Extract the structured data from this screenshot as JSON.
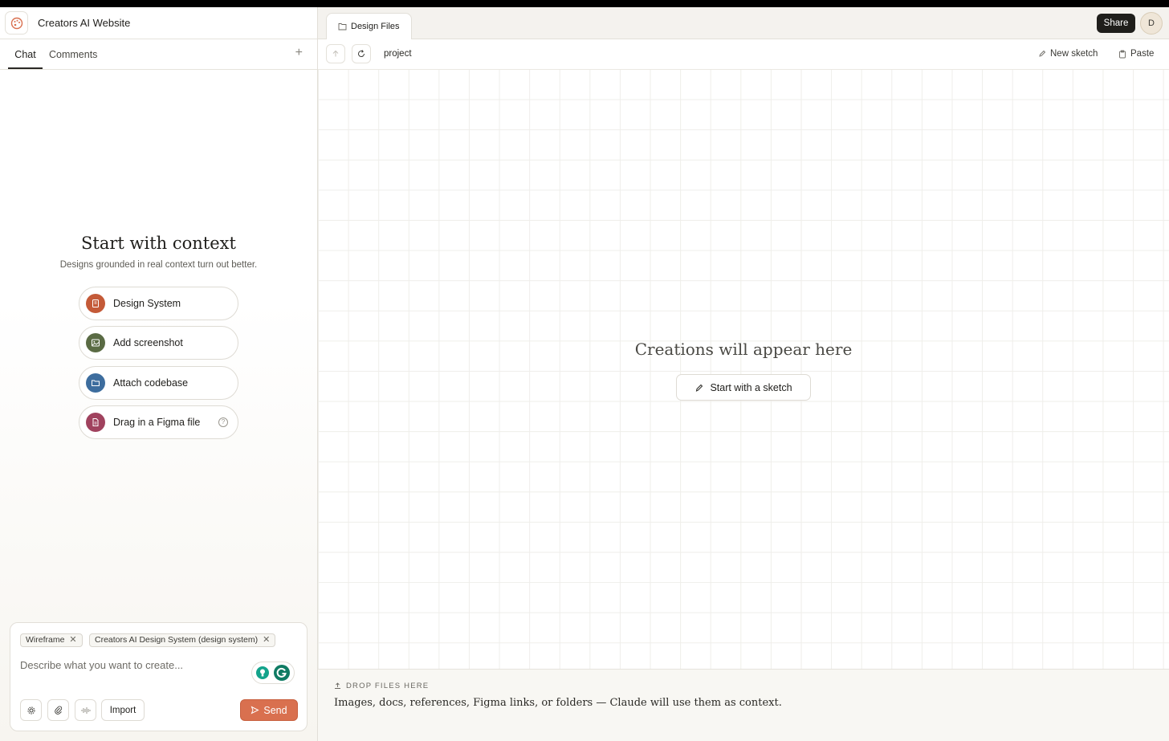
{
  "app": {
    "project_title": "Creators AI Website"
  },
  "left_tabs": {
    "chat": "Chat",
    "comments": "Comments",
    "add": "+"
  },
  "context": {
    "title": "Start with context",
    "subtitle": "Designs grounded in real context turn out better.",
    "options": [
      {
        "label": "Design System",
        "icon": "book-icon",
        "color": "#c45a38"
      },
      {
        "label": "Add screenshot",
        "icon": "image-icon",
        "color": "#5a6b44"
      },
      {
        "label": "Attach codebase",
        "icon": "folder-icon",
        "color": "#3d6d9e"
      },
      {
        "label": "Drag in a Figma file",
        "icon": "file-icon",
        "color": "#a0425e"
      }
    ],
    "help": "?"
  },
  "composer": {
    "chips": [
      {
        "label": "Wireframe"
      },
      {
        "label": "Creators AI Design System (design system)"
      }
    ],
    "chip_close": "✕",
    "placeholder": "Describe what you want to create...",
    "import_label": "Import",
    "send_label": "Send",
    "accent_color": "#d9704f"
  },
  "right_header": {
    "file_tab": "Design Files",
    "share": "Share",
    "avatar_initial": "D"
  },
  "toolbar": {
    "breadcrumb": "project",
    "new_sketch": "New sketch",
    "paste": "Paste"
  },
  "canvas": {
    "empty_title": "Creations will appear here",
    "sketch_button": "Start with a sketch"
  },
  "dropzone": {
    "label": "DROP FILES HERE",
    "description": "Images, docs, references, Figma links, or folders — Claude will use them as context."
  }
}
